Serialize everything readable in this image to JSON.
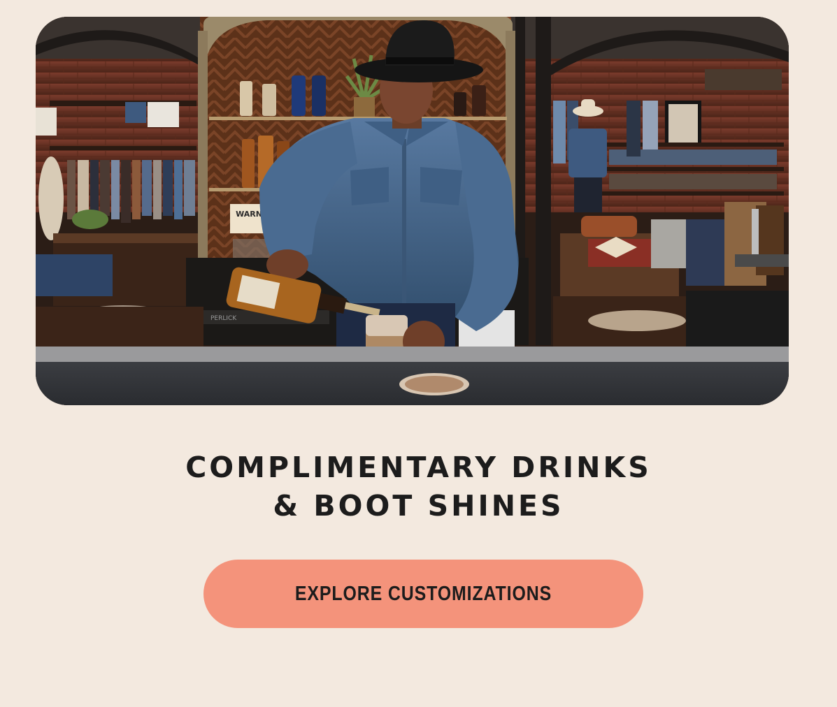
{
  "hero": {
    "sign_text": "WARN",
    "bar_label": "PERLICK"
  },
  "headline": {
    "line1": "COMPLIMENTARY DRINKS",
    "line2": "& BOOT SHINES"
  },
  "cta": {
    "label": "EXPLORE CUSTOMIZATIONS"
  },
  "colors": {
    "background": "#f3e9df",
    "button": "#f4937b",
    "text": "#1c1c1c"
  }
}
